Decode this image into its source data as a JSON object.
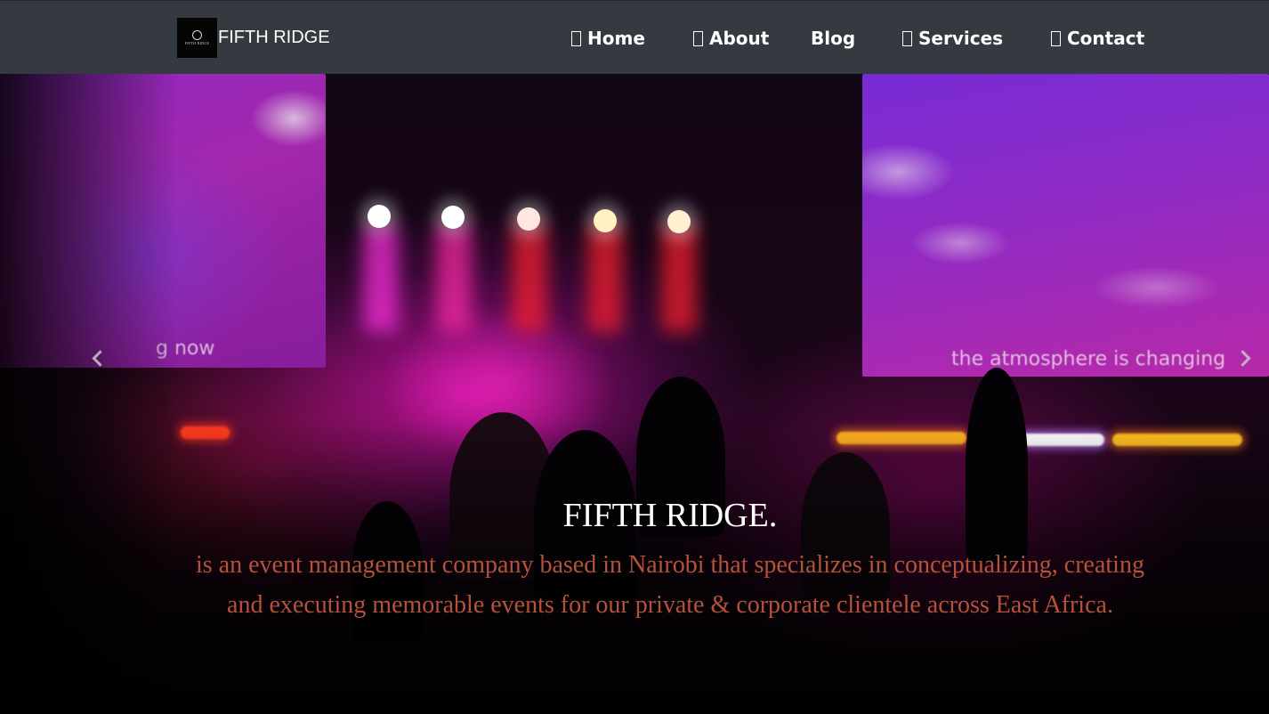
{
  "brand": {
    "logo_text": "FIFTH RIDGE",
    "name": "FIFTH RIDGE"
  },
  "nav": {
    "items": [
      {
        "label": "Home",
        "icon": "home-icon"
      },
      {
        "label": "About",
        "icon": "info-icon"
      },
      {
        "label": "Blog",
        "icon": null
      },
      {
        "label": "Services",
        "icon": "services-icon"
      },
      {
        "label": "Contact",
        "icon": "contact-icon"
      }
    ]
  },
  "hero": {
    "title": "FIFTH RIDGE.",
    "description": "is an event management company based in Nairobi that specializes in conceptualizing, creating and executing memorable events for our private & corporate clientele across East Africa.",
    "screen_left_text": "g now",
    "screen_right_text": "the atmosphere is changing"
  },
  "colors": {
    "navbar_bg": "#353a40",
    "caption_text": "#b4533a",
    "caption_title": "#ffffff"
  }
}
